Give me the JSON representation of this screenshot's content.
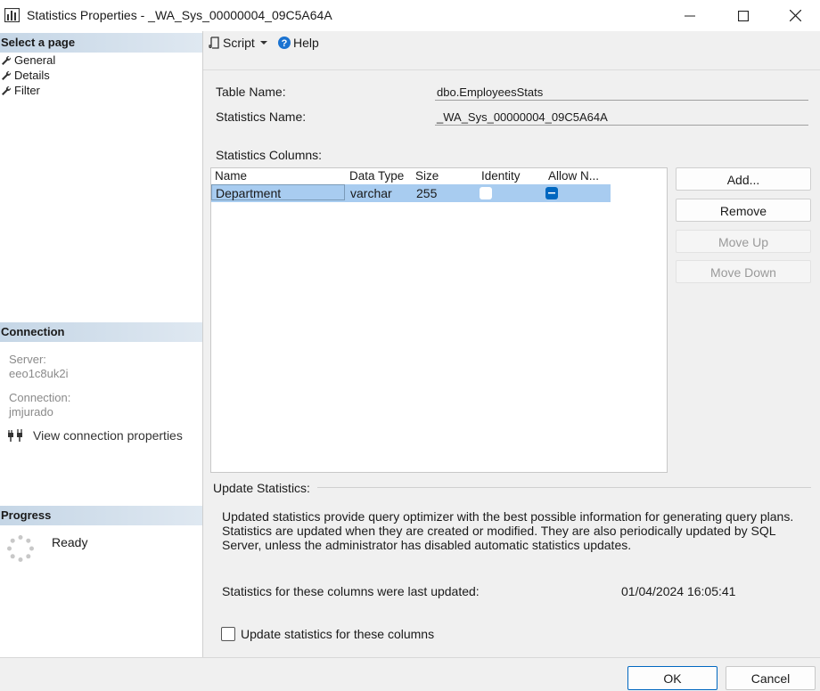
{
  "window": {
    "title": "Statistics Properties - _WA_Sys_00000004_09C5A64A",
    "icon": "bar-chart-icon",
    "controls": [
      "minimize-icon",
      "maximize-icon",
      "close-icon"
    ]
  },
  "left_pane": {
    "select_page_header": "Select a page",
    "pages": [
      {
        "label": "General",
        "icon": "wrench-icon"
      },
      {
        "label": "Details",
        "icon": "wrench-icon"
      },
      {
        "label": "Filter",
        "icon": "wrench-icon"
      }
    ],
    "connection": {
      "header": "Connection",
      "server_label": "Server:",
      "server_value": "eeo1c8uk2i",
      "connection_label": "Connection:",
      "connection_value": "jmjurado",
      "view_properties_link": "View connection properties"
    },
    "progress": {
      "header": "Progress",
      "status": "Ready"
    }
  },
  "toolbar": {
    "script_label": "Script",
    "help_label": "Help"
  },
  "form": {
    "table_name_label": "Table Name:",
    "table_name_value": "dbo.EmployeesStats",
    "statistics_name_label": "Statistics Name:",
    "statistics_name_value": "_WA_Sys_00000004_09C5A64A",
    "statistics_columns_label": "Statistics Columns:"
  },
  "grid": {
    "headers": [
      "Name",
      "Data Type",
      "Size",
      "Identity",
      "Allow N..."
    ],
    "rows": [
      {
        "name": "Department",
        "data_type": "varchar",
        "size": "255",
        "identity": false,
        "allow_nulls": true
      }
    ]
  },
  "side_buttons": {
    "add": "Add...",
    "remove": "Remove",
    "move_up": "Move Up",
    "move_down": "Move Down"
  },
  "update_stats": {
    "group_label": "Update Statistics:",
    "description": "Updated statistics provide query optimizer with the best possible information for generating query plans. Statistics are updated when they are created or modified. They are also periodically updated by SQL Server, unless the administrator has disabled automatic statistics updates.",
    "last_updated_label": "Statistics for these columns were last updated:",
    "last_updated_value": "01/04/2024 16:05:41",
    "checkbox_label": "Update statistics for these columns",
    "checkbox_checked": false
  },
  "footer": {
    "ok": "OK",
    "cancel": "Cancel"
  },
  "colors": {
    "selection": "#a8ccf0",
    "section_header": "#c5d6e6",
    "checkbox_accent": "#0067c0"
  }
}
